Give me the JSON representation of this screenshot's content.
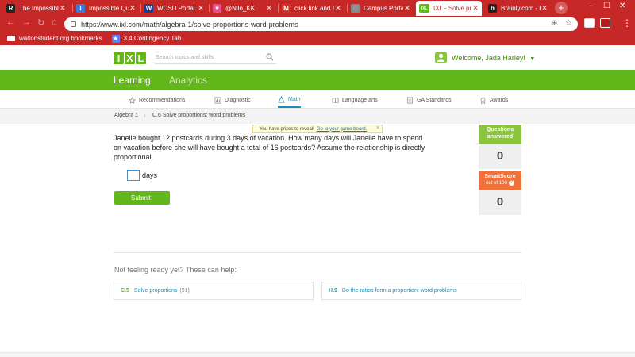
{
  "browser": {
    "tabs": [
      {
        "title": "The Impossible Quiz",
        "favicon_letter": "R",
        "favicon_color": "#222222",
        "active": false
      },
      {
        "title": "Impossible Quiz",
        "favicon_letter": "T",
        "favicon_color": "#3d7bd6",
        "active": false
      },
      {
        "title": "WCSD Portal",
        "favicon_letter": "W",
        "favicon_color": "#1a3d8f",
        "active": false
      },
      {
        "title": "@Nilo_KK",
        "favicon_letter": "♥",
        "favicon_color": "#e6508a",
        "active": false
      },
      {
        "title": "click link and ans",
        "favicon_letter": "M",
        "favicon_color": "#d93025",
        "active": false
      },
      {
        "title": "Campus Portal",
        "favicon_letter": "◌",
        "favicon_color": "#8a8a8a",
        "active": false
      },
      {
        "title": "IXL - Solve propo",
        "favicon_letter": "IXL",
        "favicon_color": "#62b81a",
        "active": true
      },
      {
        "title": "Brainly.com - For",
        "favicon_letter": "b",
        "favicon_color": "#222222",
        "active": false
      }
    ],
    "url": "https://www.ixl.com/math/algebra-1/solve-proportions-word-problems",
    "bookmarks": [
      {
        "label": "waltonstudent.org bookmarks",
        "icon": "folder-icon"
      },
      {
        "label": "3.4 Contingency Tab",
        "icon": "grid-icon"
      }
    ]
  },
  "header": {
    "logo_letters": [
      "I",
      "X",
      "L"
    ],
    "search_placeholder": "Search topics and skills",
    "welcome": "Welcome, Jada Harley!"
  },
  "nav": {
    "primary": [
      "Learning",
      "Analytics"
    ],
    "subjects": [
      "Recommendations",
      "Diagnostic",
      "Math",
      "Language arts",
      "GA Standards",
      "Awards"
    ]
  },
  "breadcrumb": {
    "course": "Algebra 1",
    "skill": "C.6 Solve proportions: word problems"
  },
  "prize": {
    "text": "You have prizes to reveal!",
    "link": "Go to your game board."
  },
  "question": {
    "text": "Janelle bought 12 postcards during 3 days of vacation. How many days will Janelle have to spend on vacation before she will have bought a total of 16 postcards? Assume the relationship is directly proportional.",
    "answer_value": "",
    "unit": "days",
    "submit_label": "Submit"
  },
  "stats": {
    "questions_label_1": "Questions",
    "questions_label_2": "answered",
    "questions_value": "0",
    "smartscore_label": "SmartScore",
    "smartscore_sub": "out of 100",
    "smartscore_value": "0"
  },
  "help": {
    "heading": "Not feeling ready yet? These can help:",
    "cards": [
      {
        "code": "C.5",
        "title": "Solve proportions",
        "count": "(91)",
        "code_color": "#62b81a"
      },
      {
        "code": "H.9",
        "title": "Do the ratios form a proportion: word problems",
        "count": "",
        "code_color": "#1a8fb5"
      }
    ]
  },
  "colors": {
    "chrome_red": "#c62828",
    "ixl_green": "#62b81a",
    "smartscore_orange": "#f0713a",
    "link_blue": "#1a8fb5"
  }
}
